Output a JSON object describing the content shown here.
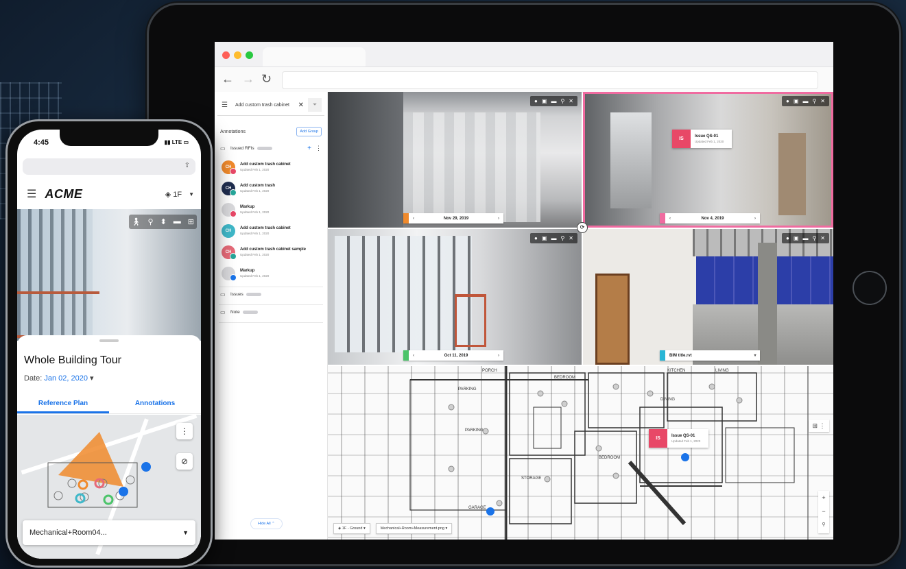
{
  "browser": {
    "back_icon": "arrow-left-icon",
    "forward_icon": "arrow-right-icon",
    "reload_icon": "reload-icon"
  },
  "sidebar": {
    "search_value": "Add custom trash cabinet",
    "annotations_title": "Annotations",
    "add_group_label": "Add Group",
    "groups": [
      {
        "label": "Issued RFIs"
      },
      {
        "label": "Issues"
      },
      {
        "label": "Note"
      }
    ],
    "items": [
      {
        "title": "Add custom trash cabinet",
        "sub": "Updated Feb 1, 2020",
        "initials": "CH",
        "color": "#f08a2c",
        "mini": "#e84867"
      },
      {
        "title": "Add custom trash",
        "sub": "Updated Feb 1, 2020",
        "initials": "CH",
        "color": "#1f2d4f",
        "mini": "#26a69a"
      },
      {
        "title": "Markup",
        "sub": "Updated Feb 1, 2020",
        "initials": "",
        "color": "#d9d9dc",
        "mini": "#e84867"
      },
      {
        "title": "Add custom trash cabinet",
        "sub": "Updated Feb 1, 2020",
        "initials": "CH",
        "color": "#3fb8c9",
        "mini": ""
      },
      {
        "title": "Add custom trash cabinet sample",
        "sub": "Updated Feb 1, 2020",
        "initials": "CH",
        "color": "#e66a78",
        "mini": "#26a69a"
      },
      {
        "title": "Markup",
        "sub": "Updated Feb 1, 2020",
        "initials": "",
        "color": "#d9d9dc",
        "mini": "#1a73e8"
      }
    ],
    "hide_all_label": "Hide All"
  },
  "viewers": [
    {
      "date": "Nov 29, 2019",
      "accent": "#f08a2c"
    },
    {
      "date": "Nov 4, 2019",
      "accent": "#f06ba0"
    },
    {
      "date": "Oct 11, 2019",
      "accent": "#4cc46a"
    },
    {
      "date": "BIM title.rvt",
      "accent": "#29b6d6"
    }
  ],
  "issue_card": {
    "badge": "IS",
    "title": "Issue QS-01",
    "sub": "Updated Feb 1, 2020"
  },
  "plan": {
    "floor_select": "1F - Ground",
    "sheet_select": "Mechanical+Room+Measurement.png",
    "labels": [
      "PARKING",
      "PARKING",
      "BEDROOM",
      "BEDROOM",
      "KITCHEN",
      "LIVING",
      "DINING",
      "STORAGE",
      "GARAGE",
      "PORCH"
    ]
  },
  "phone": {
    "time": "4:45",
    "signal": "LTE",
    "brand": "ACME",
    "floor": "1F",
    "title": "Whole Building Tour",
    "date_label": "Date:",
    "date_value": "Jan 02, 2020",
    "tabs": [
      "Reference Plan",
      "Annotations"
    ],
    "bottom_select": "Mechanical+Room04..."
  }
}
